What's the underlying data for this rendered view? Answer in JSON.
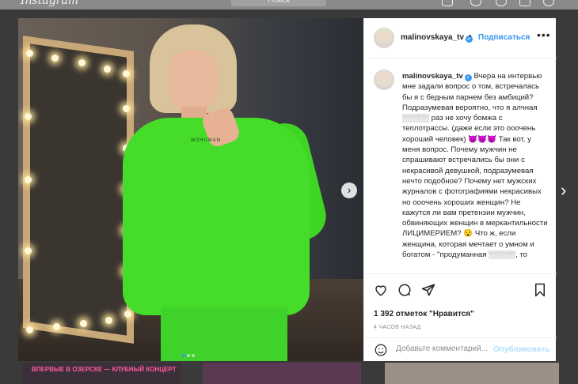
{
  "topbar": {
    "logo": "Instagram",
    "search_placeholder": "Поиск"
  },
  "post": {
    "username": "malinovskaya_tv",
    "separator": "•",
    "follow_label": "Подписаться",
    "more_label": "•••",
    "caption_username": "malinovskaya_tv",
    "caption_text": "Вчера на интервью мне задали вопрос о том, встречалась бы я с бедным парнем без амбиций? Подразумевая вероятно, что я алчная ░░░░░ раз не хочу бомжа с теплотрассы. (даже если это ооочень хороший человек) 😈😈😈 Так вот, у меня вопрос. Почему мужчин не спрашивают встречались бы они с некрасивой девушкой, подразумевая нечто подобное? Почему нет мужских журналов с фотографиями некрасивых но ооочень хороших женщин? Не кажутся ли вам претензии мужчин, обвиняющих женщин в меркантильности ЛИЦИМЕРИЕМ? 😧 Что ж, если женщина, которая мечтает о умном и богатом - \"продуманная ░░░░░, то",
    "likes": "1 392 отметок \"Нравится\"",
    "time": "4 ЧАСОВ НАЗАД",
    "comment_placeholder": "Добавьте комментарий...",
    "publish_label": "Опубликовать",
    "photo_brand": "W2HUMAN",
    "carousel": {
      "count": 3,
      "active": 1
    }
  },
  "thumbnails": {
    "first_caption": "ВПЕРВЫЕ В ОЗЕРСКЕ — КЛУБНЫЙ КОНЦЕРТ"
  },
  "colors": {
    "accent": "#3897f0",
    "sweatshirt": "#45dd2a"
  }
}
